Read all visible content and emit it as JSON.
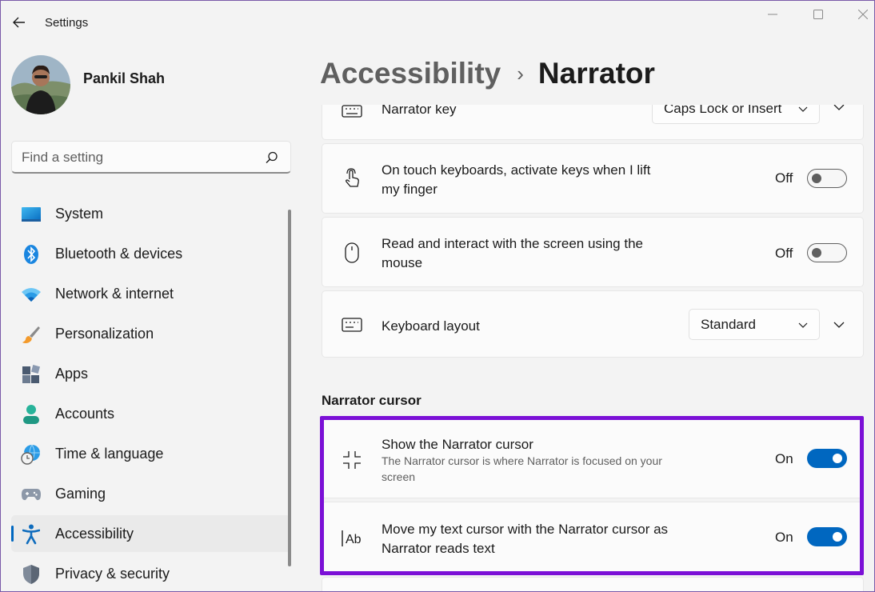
{
  "window": {
    "app_title": "Settings",
    "controls": {
      "minimize_icon": "minimize-icon",
      "maximize_icon": "maximize-icon",
      "close_icon": "close-icon"
    }
  },
  "profile": {
    "name": "Pankil Shah"
  },
  "search": {
    "placeholder": "Find a setting"
  },
  "nav": {
    "items": [
      {
        "label": "System",
        "icon": "monitor-icon",
        "active": false
      },
      {
        "label": "Bluetooth & devices",
        "icon": "bluetooth-icon",
        "active": false
      },
      {
        "label": "Network & internet",
        "icon": "wifi-icon",
        "active": false
      },
      {
        "label": "Personalization",
        "icon": "brush-icon",
        "active": false
      },
      {
        "label": "Apps",
        "icon": "apps-icon",
        "active": false
      },
      {
        "label": "Accounts",
        "icon": "person-icon",
        "active": false
      },
      {
        "label": "Time & language",
        "icon": "globe-clock-icon",
        "active": false
      },
      {
        "label": "Gaming",
        "icon": "gamepad-icon",
        "active": false
      },
      {
        "label": "Accessibility",
        "icon": "accessibility-icon",
        "active": true
      },
      {
        "label": "Privacy & security",
        "icon": "shield-icon",
        "active": false
      }
    ]
  },
  "breadcrumb": {
    "parent": "Accessibility",
    "separator": "›",
    "current": "Narrator"
  },
  "settings": {
    "narrator_key": {
      "title": "Narrator key",
      "value": "Caps Lock or Insert",
      "icon": "keyboard-icon"
    },
    "touch_keyboards": {
      "title": "On touch keyboards, activate keys when I lift my finger",
      "state": "Off",
      "icon": "touch-icon"
    },
    "mouse": {
      "title": "Read and interact with the screen using the mouse",
      "state": "Off",
      "icon": "mouse-icon"
    },
    "keyboard_layout": {
      "title": "Keyboard layout",
      "value": "Standard",
      "icon": "keyboard-layout-icon"
    }
  },
  "narrator_cursor": {
    "section_title": "Narrator cursor",
    "show_cursor": {
      "title": "Show the Narrator cursor",
      "subtitle": "The Narrator cursor is where Narrator is focused on your screen",
      "state": "On",
      "icon": "focus-frame-icon"
    },
    "move_text_cursor": {
      "title": "Move my text cursor with the Narrator cursor as Narrator reads text",
      "state": "On",
      "icon": "text-cursor-icon"
    }
  },
  "colors": {
    "accent": "#0067c0",
    "highlight": "#7b10d6"
  }
}
